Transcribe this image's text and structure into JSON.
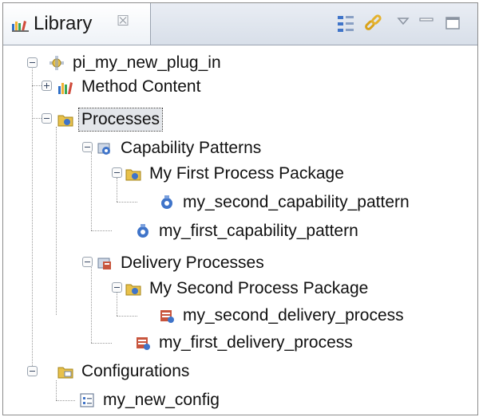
{
  "view": {
    "title": "Library",
    "close_glyph": "☒",
    "toolbar": {
      "layout_icon": "layout-icon",
      "link_icon": "link-with-editor-icon",
      "menu_icon": "view-menu-icon",
      "minimize_icon": "minimize-icon",
      "maximize_icon": "maximize-icon"
    }
  },
  "tree": {
    "plugin": "pi_my_new_plug_in",
    "method_content": "Method Content",
    "processes": "Processes",
    "capability_patterns": "Capability Patterns",
    "first_process_package": "My First Process Package",
    "second_capability_pattern": "my_second_capability_pattern",
    "first_capability_pattern": "my_first_capability_pattern",
    "delivery_processes": "Delivery Processes",
    "second_process_package": "My Second Process Package",
    "second_delivery_process": "my_second_delivery_process",
    "first_delivery_process": "my_first_delivery_process",
    "configurations": "Configurations",
    "new_config": "my_new_config"
  },
  "colors": {
    "selection": "#e3e6ea",
    "header_gradient_top": "#e9edf4",
    "folder_yellow": "#e8c14a",
    "process_blue": "#3f74c9"
  }
}
